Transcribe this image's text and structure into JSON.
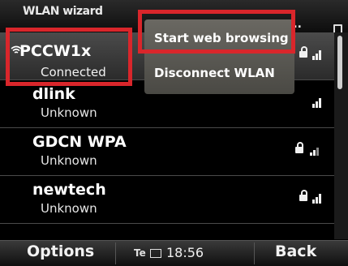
{
  "window": {
    "title": "WLAN wizard",
    "ellipsis": "..."
  },
  "networks": [
    {
      "ssid": "PCCW1x",
      "status": "Connected"
    },
    {
      "ssid": "dlink",
      "status": "Unknown"
    },
    {
      "ssid": "GDCN WPA",
      "status": "Unknown"
    },
    {
      "ssid": "newtech",
      "status": "Unknown"
    }
  ],
  "popup_menu": {
    "items": [
      {
        "label": "Start web browsing"
      },
      {
        "label": "Disconnect WLAN"
      }
    ]
  },
  "softkeys": {
    "left": "Options",
    "right": "Back",
    "indicator": "Te",
    "time": "18:56"
  },
  "icons": {
    "wifi": "wifi-icon",
    "lock": "lock-icon",
    "signal": "signal-strength-icon",
    "message": "envelope-icon"
  },
  "colors": {
    "highlight": "#d9262b",
    "background": "#000000",
    "menu": "#5b5a55"
  }
}
